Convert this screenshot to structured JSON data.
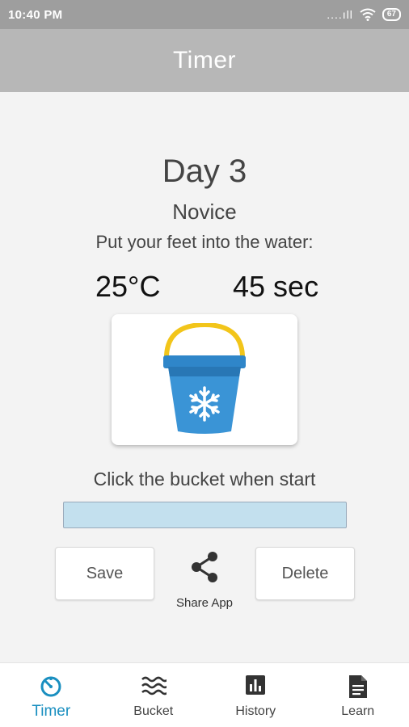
{
  "status_bar": {
    "time": "10:40 PM",
    "signal_dots": "....ıll",
    "battery": "67"
  },
  "app_bar": {
    "title": "Timer"
  },
  "session": {
    "day": "Day 3",
    "level": "Novice",
    "instruction": "Put your feet into the water:",
    "temperature": "25°C",
    "duration": "45 sec"
  },
  "bucket": {
    "icon": "ice-bucket-icon",
    "colors": {
      "bucket": "#2f86c9",
      "handle": "#f2c51a",
      "snowflake": "#ffffff"
    }
  },
  "hint": "Click the bucket when start",
  "progress": {
    "fraction": 0,
    "color": "#c3e0ee"
  },
  "actions": {
    "save_label": "Save",
    "share_label": "Share App",
    "delete_label": "Delete"
  },
  "nav": {
    "items": [
      {
        "label": "Timer",
        "icon": "timer-icon",
        "active": true
      },
      {
        "label": "Bucket",
        "icon": "waves-icon",
        "active": false
      },
      {
        "label": "History",
        "icon": "bar-chart-icon",
        "active": false
      },
      {
        "label": "Learn",
        "icon": "document-icon",
        "active": false
      }
    ],
    "active_color": "#1a8fc0"
  }
}
